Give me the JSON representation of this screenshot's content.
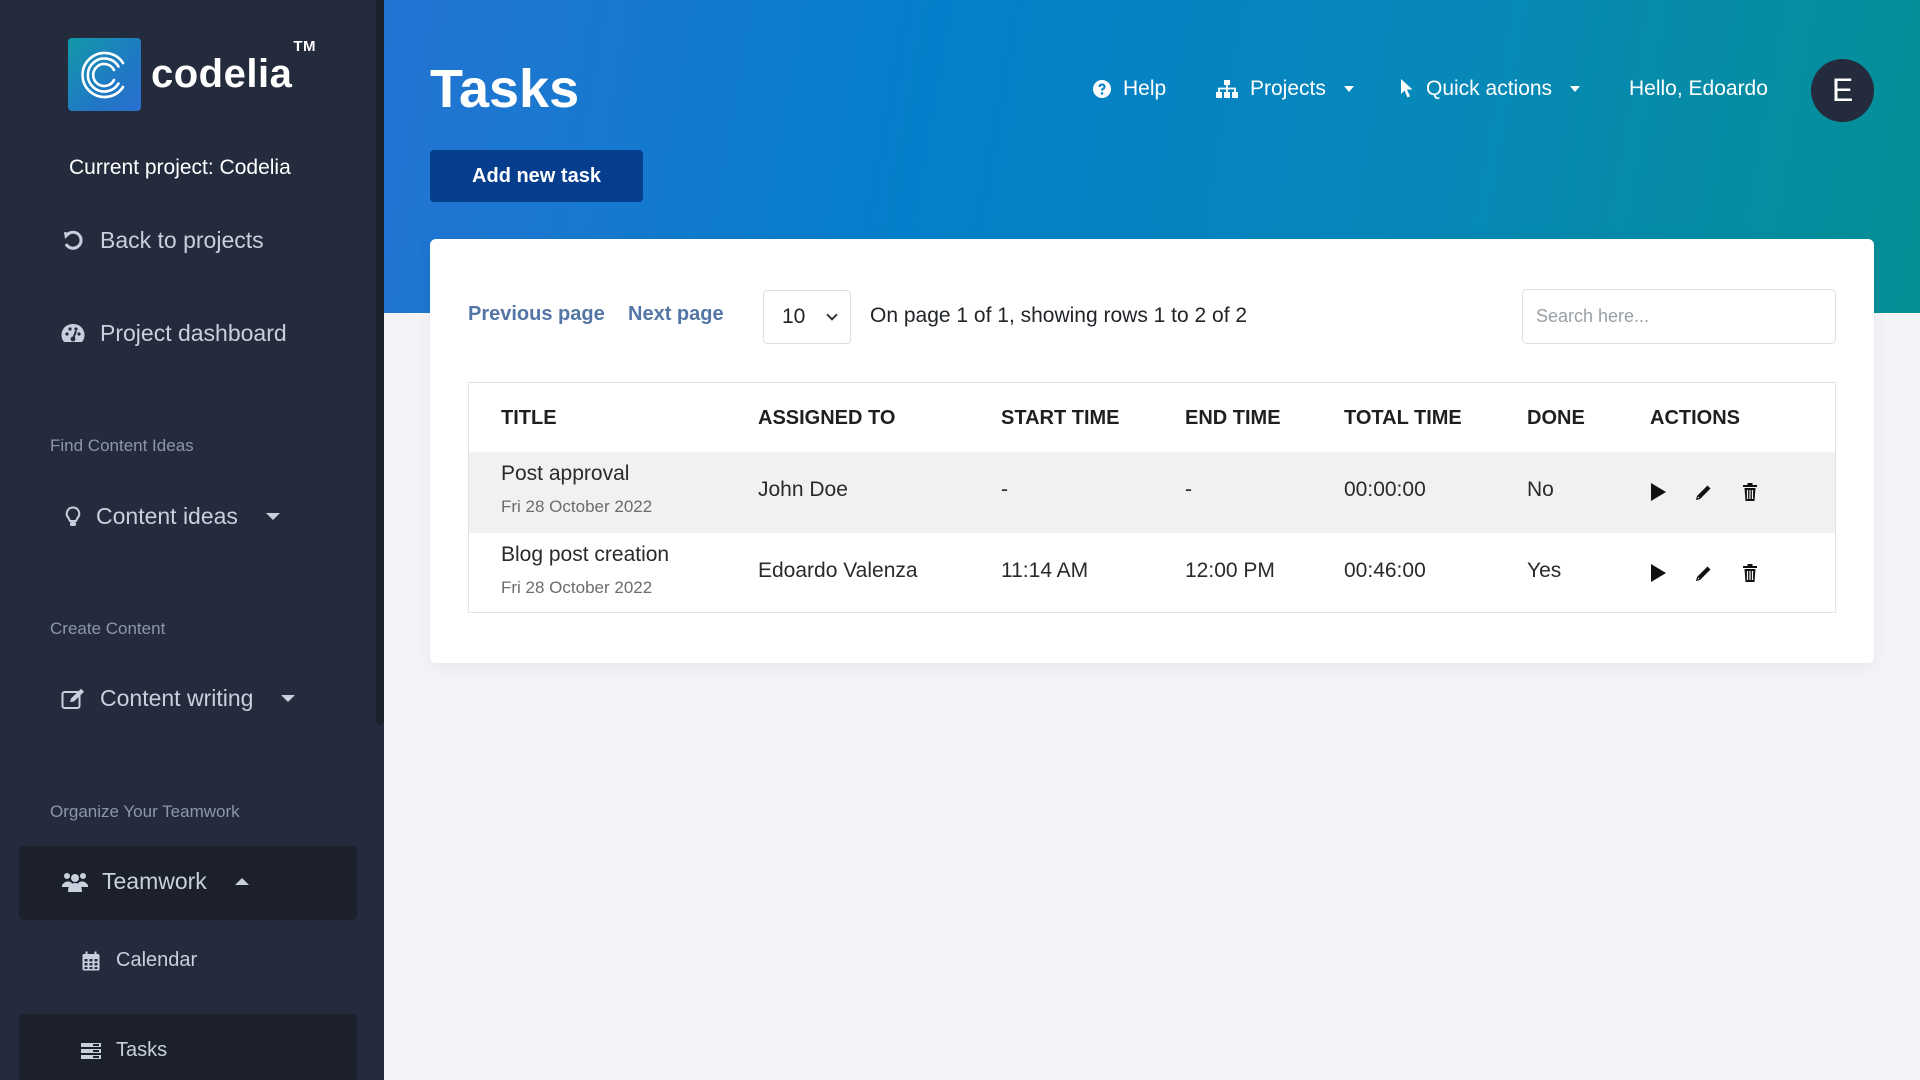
{
  "sidebar": {
    "brand": {
      "name": "codelia",
      "trademark": "TM"
    },
    "current_project": "Current project: Codelia",
    "back_link": {
      "label": "Back to projects",
      "icon": "undo-icon"
    },
    "dashboard": {
      "label": "Project dashboard",
      "icon": "gauge-icon"
    },
    "sections": [
      {
        "label": "Find Content Ideas",
        "item": {
          "label": "Content ideas",
          "icon": "lightbulb-icon",
          "expanded": false
        }
      },
      {
        "label": "Create Content",
        "item": {
          "label": "Content writing",
          "icon": "edit-icon",
          "expanded": false
        }
      },
      {
        "label": "Organize Your Teamwork",
        "item": {
          "label": "Teamwork",
          "icon": "users-icon",
          "expanded": true,
          "children": [
            {
              "label": "Calendar",
              "icon": "calendar-icon",
              "active": false
            },
            {
              "label": "Tasks",
              "icon": "tasks-icon",
              "active": true
            }
          ]
        }
      }
    ]
  },
  "header": {
    "title": "Tasks",
    "add_button": "Add new task",
    "nav": {
      "help": "Help",
      "projects": "Projects",
      "quick_actions": "Quick actions",
      "greeting": "Hello, Edoardo",
      "avatar_initial": "E"
    },
    "colors": {
      "gradient_start": "#2474d2",
      "gradient_end": "#059095",
      "button": "#063d8c"
    }
  },
  "pagination": {
    "previous": "Previous page",
    "next": "Next page",
    "page_size": "10",
    "info": "On page 1 of 1, showing rows 1 to 2 of 2"
  },
  "search": {
    "placeholder": "Search here...",
    "value": ""
  },
  "table": {
    "columns": [
      "TITLE",
      "ASSIGNED TO",
      "START TIME",
      "END TIME",
      "TOTAL TIME",
      "DONE",
      "ACTIONS"
    ],
    "rows": [
      {
        "title": "Post approval",
        "date": "Fri 28 October 2022",
        "assigned_to": "John Doe",
        "start_time": "-",
        "end_time": "-",
        "total_time": "00:00:00",
        "done": "No"
      },
      {
        "title": "Blog post creation",
        "date": "Fri 28 October 2022",
        "assigned_to": "Edoardo Valenza",
        "start_time": "11:14 AM",
        "end_time": "12:00 PM",
        "total_time": "00:46:00",
        "done": "Yes"
      }
    ],
    "actions": [
      "play-icon",
      "pencil-icon",
      "trash-icon"
    ]
  }
}
